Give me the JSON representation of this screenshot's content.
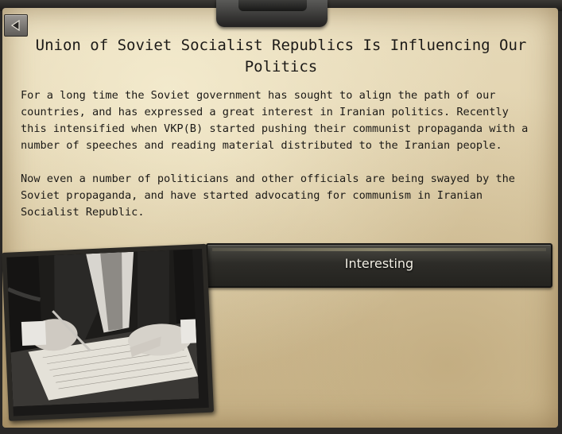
{
  "event": {
    "title": "Union of Soviet Socialist Republics Is Influencing Our Politics",
    "paragraphs": [
      "For a long time the Soviet government has sought to align the path of our countries, and has expressed a great interest in Iranian politics. Recently this intensified when VKP(B) started pushing their communist propaganda with a number of speeches and reading material distributed to the Iranian people.",
      "Now even a number of politicians and other officials are being swayed by the Soviet propaganda, and have started advocating for communism in Iranian Socialist Republic."
    ],
    "option_label": "Interesting"
  },
  "icons": {
    "back": "back-arrow-icon",
    "image": "signing-document-photo"
  }
}
